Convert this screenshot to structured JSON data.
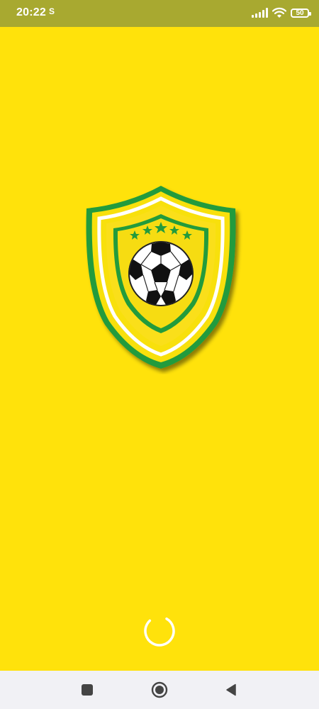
{
  "status_bar": {
    "time": "20:22",
    "sim_indicator": "S",
    "battery_level": "50",
    "icons": [
      "signal-icon",
      "wifi-icon",
      "battery-icon"
    ]
  },
  "splash": {
    "logo": "football-crest-logo",
    "loading_indicator": "spinner"
  },
  "nav_bar": {
    "buttons": [
      "recents-button",
      "home-button",
      "back-button"
    ]
  },
  "colors": {
    "background": "#FFE20B",
    "status_bar": "#A8A930",
    "crest_green": "#239B3C",
    "crest_yellow": "#F8E00C",
    "nav_bar": "#F1F1F5",
    "nav_icon": "#444444"
  }
}
